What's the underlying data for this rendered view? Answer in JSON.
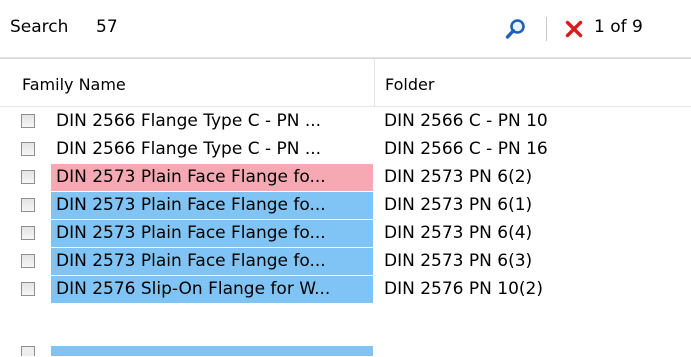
{
  "search": {
    "label": "Search",
    "value": "57",
    "counter": "1 of 9"
  },
  "columns": {
    "family": "Family Name",
    "folder": "Folder"
  },
  "colors": {
    "pink": "#f6a8b3",
    "blue": "#7fc4f5"
  },
  "rows": [
    {
      "family": "DIN 2566 Flange Type C - PN ...",
      "folder": "DIN 2566 C - PN 10",
      "highlight": "none"
    },
    {
      "family": "DIN 2566 Flange Type C - PN ...",
      "folder": "DIN 2566 C - PN 16",
      "highlight": "none"
    },
    {
      "family": "DIN 2573 Plain Face Flange fo...",
      "folder": "DIN 2573 PN 6(2)",
      "highlight": "pink"
    },
    {
      "family": "DIN 2573 Plain Face Flange fo...",
      "folder": "DIN 2573 PN 6(1)",
      "highlight": "blue"
    },
    {
      "family": "DIN 2573 Plain Face Flange fo...",
      "folder": "DIN 2573 PN 6(4)",
      "highlight": "blue"
    },
    {
      "family": "DIN 2573 Plain Face Flange fo...",
      "folder": "DIN 2573 PN 6(3)",
      "highlight": "blue"
    },
    {
      "family": "DIN 2576 Slip-On Flange for W...",
      "folder": "DIN 2576 PN 10(2)",
      "highlight": "blue"
    }
  ]
}
